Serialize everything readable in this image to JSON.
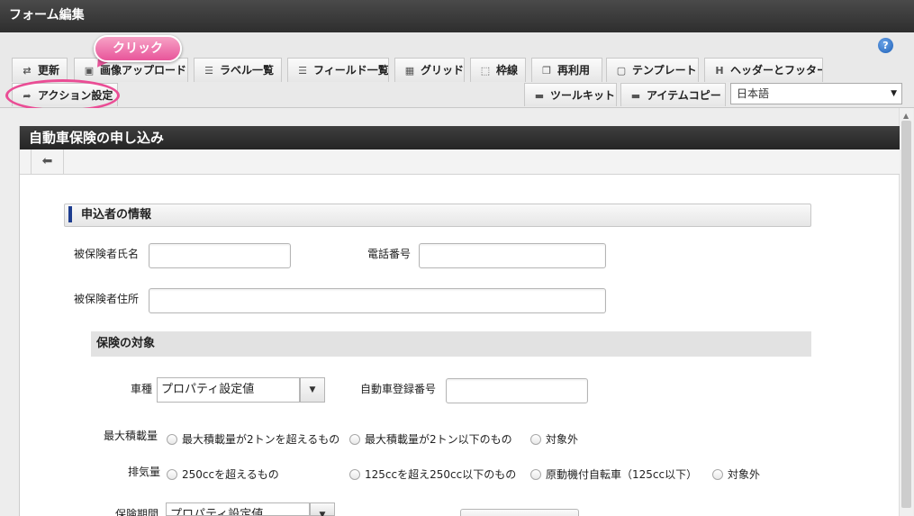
{
  "window": {
    "title": "フォーム編集"
  },
  "toolbar": {
    "tabs_row1": [
      {
        "label": "更新",
        "icon": "update-icon"
      },
      {
        "label": "画像アップロード",
        "icon": "image-upload-icon"
      },
      {
        "label": "ラベル一覧",
        "icon": "label-list-icon"
      },
      {
        "label": "フィールド一覧",
        "icon": "field-list-icon"
      },
      {
        "label": "グリッド",
        "icon": "grid-icon"
      },
      {
        "label": "枠線",
        "icon": "border-icon"
      },
      {
        "label": "再利用",
        "icon": "reuse-icon"
      },
      {
        "label": "テンプレート",
        "icon": "template-icon"
      },
      {
        "label": "ヘッダーとフッター",
        "icon": "header-footer-icon"
      }
    ],
    "tabs_row2": [
      {
        "label": "アクション設定",
        "icon": "action-settings-icon"
      },
      {
        "label": "ツールキット",
        "icon": "toolkit-icon"
      },
      {
        "label": "アイテムコピー",
        "icon": "item-copy-icon"
      }
    ],
    "language": {
      "selected": "日本語"
    },
    "help_glyph": "?",
    "icon_glyphs": {
      "update": "⇄",
      "image": "▣",
      "label_list": "☰",
      "field_list": "☰",
      "grid": "▦",
      "border": "⬚",
      "reuse": "❐",
      "template": "▢",
      "header_footer": "H",
      "action": "➦",
      "toolkit": "▬",
      "item_copy": "▬",
      "chevron": "▼",
      "back_arrow": "⬅",
      "scroll_up": "▲"
    }
  },
  "annotation": {
    "callout": "クリック",
    "highlight_color": "#ea4d95"
  },
  "form": {
    "title": "自動車保険の申し込み",
    "section_applicant": "申込者の情報",
    "fields": {
      "insured_name": "被保険者氏名",
      "phone": "電話番号",
      "insured_address": "被保険者住所"
    },
    "section_insurance": "保険の対象",
    "vehicle_type": {
      "label": "車種",
      "value": "プロパティ設定値"
    },
    "registration_number": "自動車登録番号",
    "max_load": {
      "label": "最大積載量",
      "options": [
        "最大積載量が2トンを超えるもの",
        "最大積載量が2トン以下のもの",
        "対象外"
      ]
    },
    "displacement": {
      "label": "排気量",
      "options": [
        "250ccを超えるもの",
        "125ccを超え250cc以下のもの",
        "原動機付自転車（125cc以下）",
        "対象外"
      ]
    },
    "insurance_period": {
      "label": "保険期間",
      "value": "プロパティ設定値"
    }
  },
  "colors": {
    "title_bar": "#2e2e2e",
    "section_accent": "#1e3d8f",
    "callout": "#e8559a"
  }
}
